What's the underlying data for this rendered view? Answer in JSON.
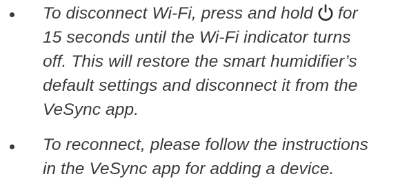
{
  "instructions": [
    {
      "lines": [
        {
          "before": "To disconnect Wi-Fi, press and hold",
          "icon": "power-icon",
          "after": "for"
        },
        {
          "text": "15 seconds until the Wi-Fi indicator turns"
        },
        {
          "text": "off. This will restore the smart humidifier’s"
        },
        {
          "text": "default settings and disconnect it from the"
        },
        {
          "text": "VeSync app."
        }
      ]
    },
    {
      "lines": [
        {
          "text": "To reconnect, please follow the instructions"
        },
        {
          "text": "in the VeSync app for adding a device."
        }
      ]
    }
  ],
  "colors": {
    "text": "#3a3a3a",
    "background": "#ffffff"
  }
}
